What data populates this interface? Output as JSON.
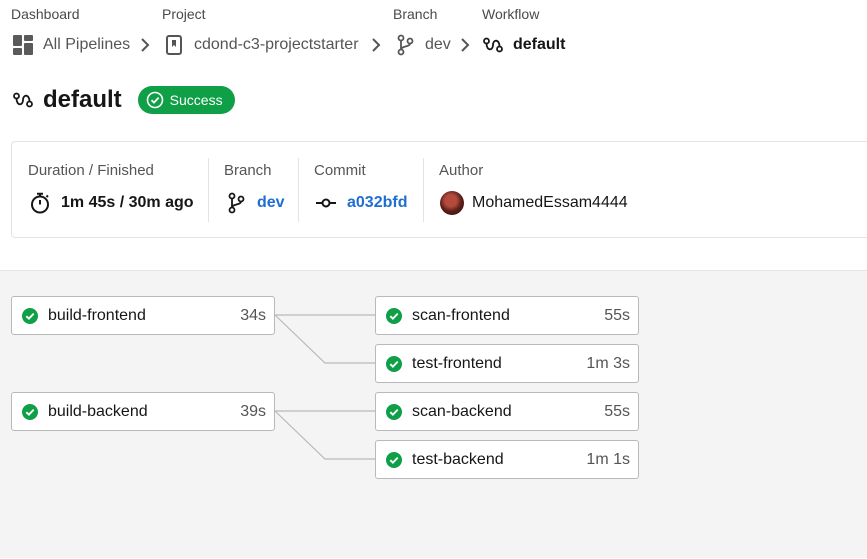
{
  "breadcrumb": {
    "dashboard": {
      "label": "Dashboard",
      "value": "All Pipelines"
    },
    "project": {
      "label": "Project",
      "value": "cdond-c3-projectstarter"
    },
    "branch": {
      "label": "Branch",
      "value": "dev"
    },
    "workflow": {
      "label": "Workflow",
      "value": "default"
    }
  },
  "workflow": {
    "title": "default",
    "status": "Success",
    "status_color": "#0e9f47"
  },
  "meta": {
    "duration": {
      "label": "Duration / Finished",
      "value": "1m 45s / 30m ago"
    },
    "branch": {
      "label": "Branch",
      "value": "dev"
    },
    "commit": {
      "label": "Commit",
      "value": "a032bfd"
    },
    "author": {
      "label": "Author",
      "value": "MohamedEssam4444"
    }
  },
  "jobs": [
    {
      "name": "build-frontend",
      "duration": "34s",
      "status": "success"
    },
    {
      "name": "scan-frontend",
      "duration": "55s",
      "status": "success"
    },
    {
      "name": "test-frontend",
      "duration": "1m 3s",
      "status": "success"
    },
    {
      "name": "build-backend",
      "duration": "39s",
      "status": "success"
    },
    {
      "name": "scan-backend",
      "duration": "55s",
      "status": "success"
    },
    {
      "name": "test-backend",
      "duration": "1m 1s",
      "status": "success"
    }
  ],
  "icons": {
    "dashboard": "dashboard-grid-icon",
    "project": "project-bookmark-icon",
    "branch": "git-branch-icon",
    "workflow": "workflow-icon",
    "timer": "stopwatch-icon",
    "commit": "git-commit-icon",
    "success": "check-circle-icon"
  },
  "colors": {
    "link": "#1f6fd1",
    "success": "#0e9f47"
  }
}
